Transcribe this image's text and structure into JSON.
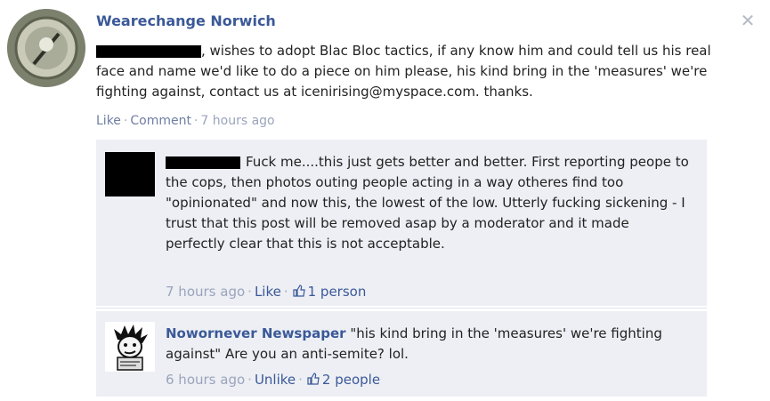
{
  "post": {
    "author": "Wearechange Norwich",
    "body": ", wishes to adopt Blac Bloc tactics, if any know him and could tell us his real face and name we'd like to do a piece on him please, his kind bring in the 'measures' we're fighting against, contact us at icenirising@myspace.com. thanks.",
    "actions": {
      "like": "Like",
      "comment": "Comment",
      "time": "7 hours ago"
    }
  },
  "comments": [
    {
      "author": "",
      "text": "Fuck me....this just gets better and better. First reporting peope to the cops, then photos outing people acting in a way otheres find too \"opinionated\" and now this, the lowest of the low. Utterly fucking sickening - I trust that this post will be removed asap by a moderator and it made perfectly clear that this is not acceptable.",
      "time": "7 hours ago",
      "like_label": "Like",
      "likes": "1 person"
    },
    {
      "author": "Nowornever Newspaper",
      "text": "\"his kind bring in the 'measures' we're fighting against\" Are you an anti-semite? lol.",
      "time": "6 hours ago",
      "like_label": "Unlike",
      "likes": "2 people"
    }
  ],
  "icons": {
    "close": "close-icon",
    "like": "thumbs-up-icon"
  },
  "colors": {
    "link": "#3b5998",
    "meta": "#9aa4bc",
    "comment_bg": "#edeff4"
  }
}
